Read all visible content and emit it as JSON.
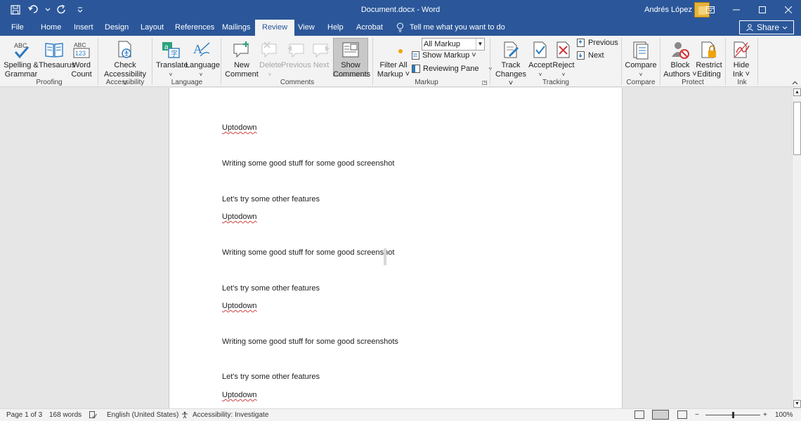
{
  "window": {
    "title": "Document.docx - Word",
    "user_name": "Andrés López"
  },
  "tabs": [
    {
      "label": "File"
    },
    {
      "label": "Home"
    },
    {
      "label": "Insert"
    },
    {
      "label": "Design"
    },
    {
      "label": "Layout"
    },
    {
      "label": "References"
    },
    {
      "label": "Mailings"
    },
    {
      "label": "Review"
    },
    {
      "label": "View"
    },
    {
      "label": "Help"
    },
    {
      "label": "Acrobat"
    }
  ],
  "active_tab": "Review",
  "tell_me": "Tell me what you want to do",
  "share_label": "Share",
  "ribbon": {
    "proofing": {
      "spelling_line1": "Spelling &",
      "spelling_line2": "Grammar",
      "thesaurus": "Thesaurus",
      "wordcount_line1": "Word",
      "wordcount_line2": "Count",
      "group": "Proofing"
    },
    "accessibility": {
      "check_line1": "Check",
      "check_line2": "Accessibility ˅",
      "group": "Accessibility"
    },
    "language": {
      "translate": "Translate",
      "language": "Language",
      "group": "Language"
    },
    "comments": {
      "new_line1": "New",
      "new_line2": "Comment",
      "delete": "Delete",
      "previous": "Previous",
      "next": "Next",
      "show_line1": "Show",
      "show_line2": "Comments",
      "group": "Comments"
    },
    "markup": {
      "filter_line1": "Filter All",
      "filter_line2": "Markup ˅",
      "combo_value": "All Markup",
      "show_markup": "Show Markup ˅",
      "reviewing_pane": "Reviewing Pane",
      "group": "Markup"
    },
    "tracking": {
      "track_line1": "Track",
      "track_line2": "Changes ˅",
      "accept": "Accept",
      "reject": "Reject",
      "previous": "Previous",
      "next": "Next",
      "group": "Tracking"
    },
    "compare": {
      "compare": "Compare",
      "group": "Compare"
    },
    "protect": {
      "block_line1": "Block",
      "block_line2": "Authors ˅",
      "restrict_line1": "Restrict",
      "restrict_line2": "Editing",
      "group": "Protect"
    },
    "ink": {
      "hide_line1": "Hide",
      "hide_line2": "Ink ˅",
      "group": "Ink"
    }
  },
  "document": {
    "lines": [
      "Uptodown",
      "Writing some good stuff for some good screenshot",
      "Let's try some other features",
      "Uptodown",
      "Writing some good stuff for some good screenshot",
      "Let's try some other features",
      "Uptodown",
      "Writing some good stuff for some good screenshots",
      "Let's try some other features",
      "Uptodown"
    ]
  },
  "status": {
    "page": "Page 1 of 3",
    "words": "168 words",
    "language": "English (United States)",
    "accessibility": "Accessibility: Investigate",
    "zoom": "100%"
  },
  "colors": {
    "title_bar": "#2b579a",
    "ribbon_bg": "#f3f3f3",
    "doc_bg": "#e6e6e6",
    "spell_underline": "#d04040"
  }
}
